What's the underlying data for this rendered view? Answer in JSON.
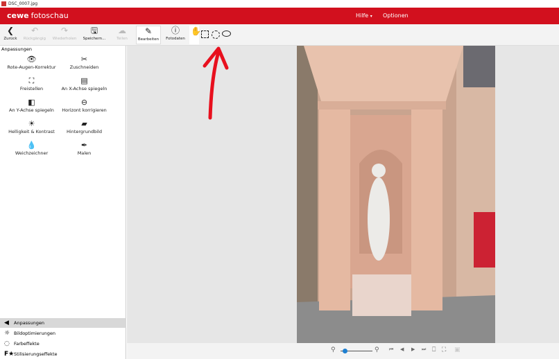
{
  "window": {
    "title": "DSC_0007.jpg"
  },
  "header": {
    "brand": "cewe",
    "product": "fotoschau",
    "menu": [
      {
        "label": "Hilfe"
      },
      {
        "label": "Optionen"
      }
    ]
  },
  "toolbar": {
    "back": "Zurück",
    "undo": "Rückgängig",
    "redo": "Wiederholen",
    "save": "Speichern...",
    "share": "Teilen",
    "edit": "Bearbeiten",
    "photodata": "Fotodaten"
  },
  "sidebar": {
    "section": "Anpassungen",
    "tools": [
      {
        "label": "Rote-Augen-Korrektur",
        "icon": "eye-icon"
      },
      {
        "label": "Zuschneiden",
        "icon": "scissors-icon"
      },
      {
        "label": "Freistellen",
        "icon": "cutout-icon"
      },
      {
        "label": "An X-Achse spiegeln",
        "icon": "flip-x-icon"
      },
      {
        "label": "An Y-Achse spiegeln",
        "icon": "flip-y-icon"
      },
      {
        "label": "Horizont korrigieren",
        "icon": "horizon-icon"
      },
      {
        "label": "Helligkeit & Kontrast",
        "icon": "brightness-icon"
      },
      {
        "label": "Hintergrundbild",
        "icon": "background-image-icon"
      },
      {
        "label": "Weichzeichner",
        "icon": "blur-drop-icon"
      },
      {
        "label": "Malen",
        "icon": "brush-icon"
      }
    ],
    "categories": [
      {
        "label": "Anpassungen"
      },
      {
        "label": "Bildoptimierungen"
      },
      {
        "label": "Farbeffekte"
      },
      {
        "label": "Stilisierungseffekte"
      }
    ]
  },
  "zoom": {
    "level": 0.05
  },
  "colors": {
    "brand": "#d2101e",
    "annotation": "#e8101e",
    "slider": "#1e7fd0"
  }
}
